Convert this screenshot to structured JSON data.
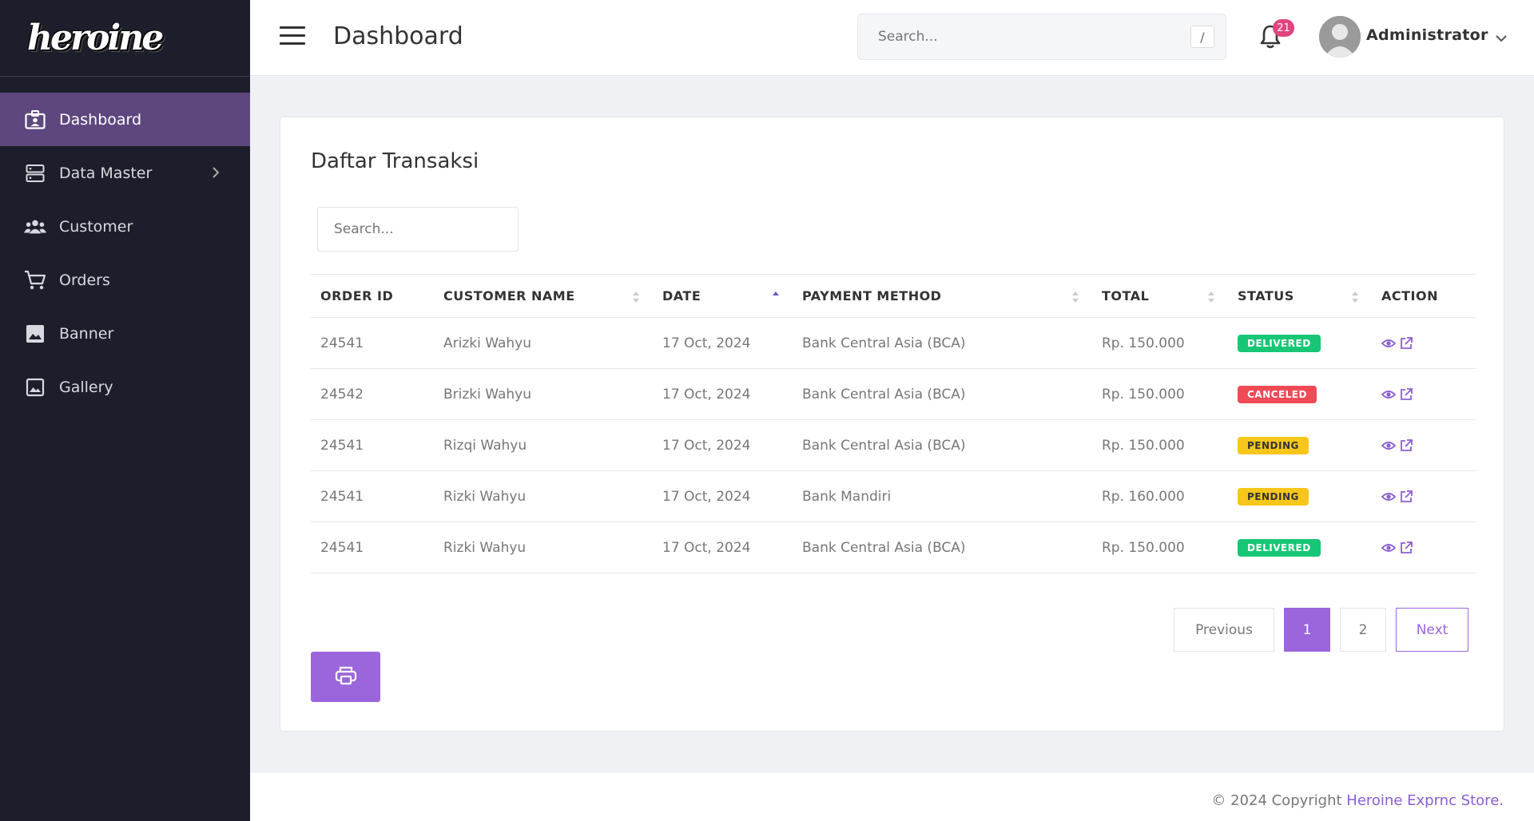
{
  "sidebar": {
    "logo_text": "heroine",
    "items": [
      {
        "label": "Dashboard",
        "icon": "id-badge-icon",
        "active": true
      },
      {
        "label": "Data Master",
        "icon": "server-icon",
        "has_children": true
      },
      {
        "label": "Customer",
        "icon": "users-icon"
      },
      {
        "label": "Orders",
        "icon": "cart-icon"
      },
      {
        "label": "Banner",
        "icon": "image-icon"
      },
      {
        "label": "Gallery",
        "icon": "gallery-icon"
      }
    ]
  },
  "header": {
    "title": "Dashboard",
    "search_placeholder": "Search...",
    "search_shortcut": "/",
    "notification_count": "21",
    "user_name": "Administrator"
  },
  "main": {
    "card_title": "Daftar Transaksi",
    "table_search_placeholder": "Search...",
    "columns": [
      "ORDER ID",
      "CUSTOMER NAME",
      "DATE",
      "PAYMENT METHOD",
      "TOTAL",
      "STATUS",
      "ACTION"
    ],
    "rows": [
      {
        "order_id": "24541",
        "customer": "Arizki Wahyu",
        "date": "17 Oct, 2024",
        "payment": "Bank Central Asia (BCA)",
        "total": "Rp. 150.000",
        "status": "DELIVERED"
      },
      {
        "order_id": "24542",
        "customer": "Brizki Wahyu",
        "date": "17 Oct, 2024",
        "payment": "Bank Central Asia (BCA)",
        "total": "Rp. 150.000",
        "status": "CANCELED"
      },
      {
        "order_id": "24541",
        "customer": "Rizqi Wahyu",
        "date": "17 Oct, 2024",
        "payment": "Bank Central Asia (BCA)",
        "total": "Rp. 150.000",
        "status": "PENDING"
      },
      {
        "order_id": "24541",
        "customer": "Rizki Wahyu",
        "date": "17 Oct, 2024",
        "payment": "Bank Mandiri",
        "total": "Rp. 160.000",
        "status": "PENDING"
      },
      {
        "order_id": "24541",
        "customer": "Rizki Wahyu",
        "date": "17 Oct, 2024",
        "payment": "Bank Central Asia (BCA)",
        "total": "Rp. 150.000",
        "status": "DELIVERED"
      }
    ],
    "status_colors": {
      "DELIVERED": "#17c776",
      "CANCELED": "#ef4a56",
      "PENDING": "#f7c61a"
    },
    "pagination": {
      "previous": "Previous",
      "pages": [
        "1",
        "2"
      ],
      "current": "1",
      "next": "Next"
    },
    "print_icon": "printer-icon"
  },
  "footer": {
    "text": "© 2024 Copyright ",
    "link": "Heroine Exprnc Store."
  },
  "colors": {
    "sidebar_bg": "#1c1f2b",
    "active_nav": "#5e477f",
    "accent": "#9b66dc"
  }
}
